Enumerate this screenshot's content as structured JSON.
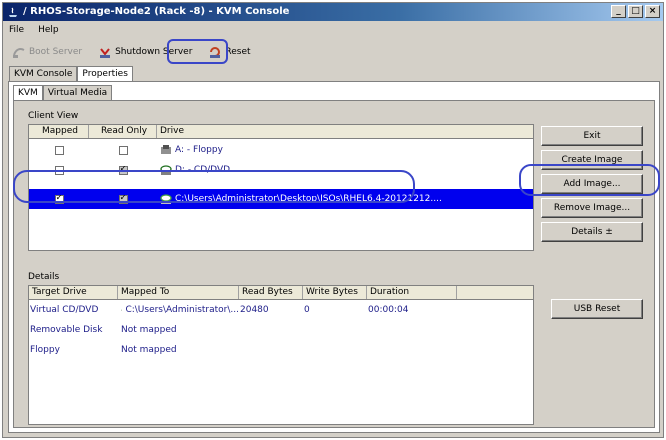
{
  "window": {
    "title": "/ RHOS-Storage-Node2 (Rack -8) - KVM Console",
    "controls": {
      "minimize": "_",
      "maximize": "□",
      "close": "×"
    }
  },
  "menu": {
    "file": "File",
    "help": "Help"
  },
  "toolbar": {
    "boot_server": "Boot Server",
    "shutdown_server": "Shutdown Server",
    "reset": "Reset"
  },
  "outer_tabs": [
    "KVM Console",
    "Properties"
  ],
  "inner_tabs": [
    "KVM",
    "Virtual Media"
  ],
  "client_view": {
    "label": "Client View",
    "columns": [
      "Mapped",
      "Read Only",
      "Drive"
    ],
    "rows": [
      {
        "mapped": false,
        "read_only": false,
        "read_only_disabled": false,
        "drive": "A: - Floppy",
        "icon": "floppy-drive-icon",
        "selected": false
      },
      {
        "mapped": false,
        "read_only": true,
        "read_only_disabled": true,
        "drive": "D: - CD/DVD",
        "icon": "cd-drive-icon",
        "selected": false
      },
      {
        "mapped": true,
        "read_only": true,
        "read_only_disabled": true,
        "drive": "C:\\Users\\Administrator\\Desktop\\ISOs\\RHEL6.4-20121212....",
        "icon": "disc-image-icon",
        "selected": true
      }
    ]
  },
  "buttons": {
    "exit": "Exit",
    "create_image": "Create Image",
    "add_image": "Add Image...",
    "remove_image": "Remove Image...",
    "details": "Details ±",
    "usb_reset": "USB Reset"
  },
  "details": {
    "label": "Details",
    "columns": [
      "Target Drive",
      "Mapped To",
      "Read Bytes",
      "Write Bytes",
      "Duration"
    ],
    "rows": [
      {
        "target": "Virtual CD/DVD",
        "mapped_to": "C:\\Users\\Administrator\\...",
        "read_bytes": "20480",
        "write_bytes": "0",
        "duration": "00:00:04",
        "has_icon": true
      },
      {
        "target": "Removable Disk",
        "mapped_to": "Not mapped",
        "read_bytes": "",
        "write_bytes": "",
        "duration": "",
        "has_icon": false
      },
      {
        "target": "Floppy",
        "mapped_to": "Not mapped",
        "read_bytes": "",
        "write_bytes": "",
        "duration": "",
        "has_icon": false
      }
    ]
  },
  "colors": {
    "selection": "#0000ee",
    "annotation": "#3a46c8",
    "title_bar": "#0a246a"
  }
}
